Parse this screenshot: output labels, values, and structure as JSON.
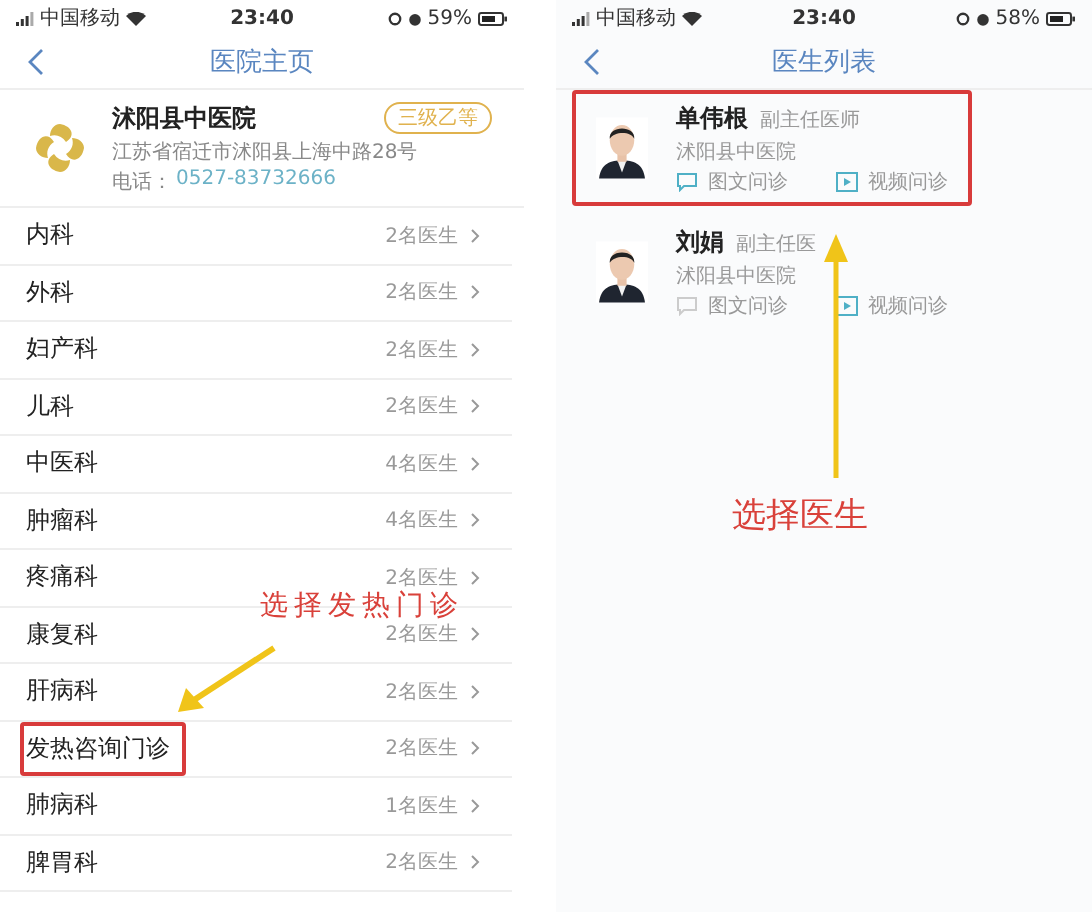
{
  "left_screen": {
    "status_bar": {
      "carrier": "中国移动",
      "time": "23:40",
      "battery": "59%"
    },
    "title": "医院主页",
    "hospital": {
      "name": "沭阳县中医院",
      "badge": "三级乙等",
      "address": "江苏省宿迁市沭阳县上海中路28号",
      "phone_label": "电话：",
      "phone": "0527-83732666"
    },
    "departments": [
      {
        "name": "内科",
        "count": "2名医生",
        "marked": false
      },
      {
        "name": "外科",
        "count": "2名医生",
        "marked": false
      },
      {
        "name": "妇产科",
        "count": "2名医生",
        "marked": false
      },
      {
        "name": "儿科",
        "count": "2名医生",
        "marked": false
      },
      {
        "name": "中医科",
        "count": "4名医生",
        "marked": false
      },
      {
        "name": "肿瘤科",
        "count": "4名医生",
        "marked": false
      },
      {
        "name": "疼痛科",
        "count": "2名医生",
        "marked": false
      },
      {
        "name": "康复科",
        "count": "2名医生",
        "marked": false
      },
      {
        "name": "肝病科",
        "count": "2名医生",
        "marked": false
      },
      {
        "name": "发热咨询门诊",
        "count": "2名医生",
        "marked": true
      },
      {
        "name": "肺病科",
        "count": "1名医生",
        "marked": false
      },
      {
        "name": "脾胃科",
        "count": "2名医生",
        "marked": false
      }
    ],
    "annotation": "选择发热门诊"
  },
  "right_screen": {
    "status_bar": {
      "carrier": "中国移动",
      "time": "23:40",
      "battery": "58%"
    },
    "title": "医生列表",
    "doctors": [
      {
        "name": "单伟根",
        "title": "副主任医师",
        "hospital": "沭阳县中医院",
        "marked": true,
        "actions": [
          {
            "kind": "text",
            "label": "图文问诊",
            "enabled": true
          },
          {
            "kind": "video",
            "label": "视频问诊",
            "enabled": true
          }
        ]
      },
      {
        "name": "刘娟",
        "title": "副主任医",
        "hospital": "沭阳县中医院",
        "marked": false,
        "actions": [
          {
            "kind": "text",
            "label": "图文问诊",
            "enabled": false
          },
          {
            "kind": "video",
            "label": "视频问诊",
            "enabled": true
          }
        ]
      }
    ],
    "annotation": "选择医生"
  }
}
